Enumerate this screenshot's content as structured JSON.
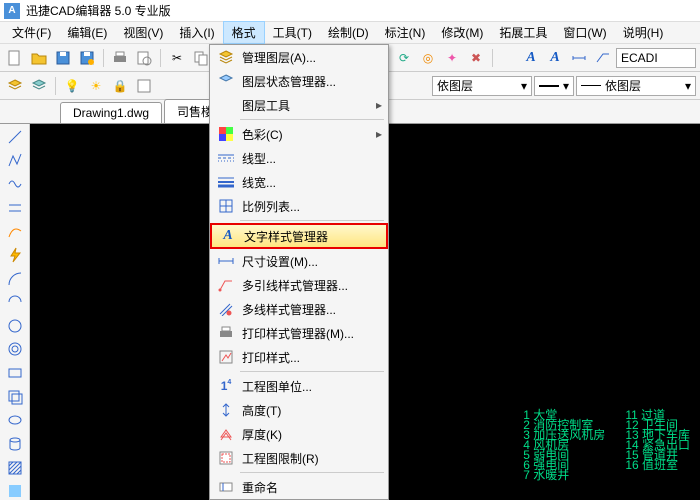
{
  "title": "迅捷CAD编辑器 5.0 专业版",
  "menubar": {
    "file": "文件(F)",
    "edit": "编辑(E)",
    "view": "视图(V)",
    "insert": "插入(I)",
    "format": "格式",
    "tool": "工具(T)",
    "draw": "绘制(D)",
    "annotate": "标注(N)",
    "modify": "修改(M)",
    "extend": "拓展工具",
    "window": "窗口(W)",
    "help": "说明(H)"
  },
  "toolbar2": {
    "right_combo1": "依图层",
    "right_combo2": "依图层",
    "right_input": "ECADI"
  },
  "tabs": {
    "tab1": "Drawing1.dwg",
    "tab2": "司售楼一层"
  },
  "dropdown": {
    "manage_layer": "管理图层(A)...",
    "layer_state_mgr": "图层状态管理器...",
    "layer_tools": "图层工具",
    "color": "色彩(C)",
    "linetype": "线型...",
    "lineweight": "线宽...",
    "scale_list": "比例列表...",
    "text_style_mgr": "文字样式管理器",
    "dim_settings": "尺寸设置(M)...",
    "mleader_style": "多引线样式管理器...",
    "mline_style": "多线样式管理器...",
    "plot_style": "打印样式管理器(M)...",
    "print_style": "打印样式...",
    "drawing_units": "工程图单位...",
    "height": "高度(T)",
    "thickness": "厚度(K)",
    "drawing_limits": "工程图限制(R)",
    "rename": "重命名"
  },
  "canvas_notes": {
    "col1": [
      "1 大堂",
      "2 消防控制室",
      "3 加压送风机房",
      "4 风机房",
      "5 弱电间",
      "6 强电间",
      "7 水暖井"
    ],
    "col2": [
      "11 过道",
      "12 卫生间",
      "13 地下车库",
      "14 紧急出口",
      "15 管道井",
      "16 值班室"
    ]
  }
}
